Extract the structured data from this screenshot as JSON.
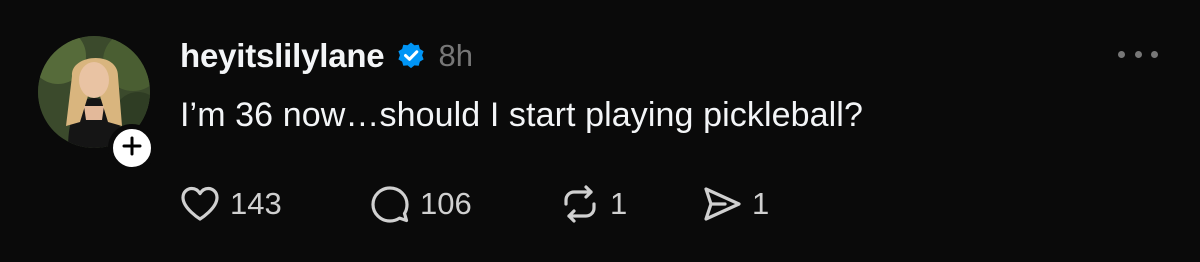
{
  "post": {
    "username": "heyitslilylane",
    "verified": true,
    "timestamp": "8h",
    "text": "I’m 36 now…should I start playing pickleball?",
    "actions": {
      "likes": "143",
      "comments": "106",
      "reposts": "1",
      "shares": "1"
    },
    "icons": {
      "like": "heart-icon",
      "comment": "comment-bubble-icon",
      "repost": "repost-icon",
      "share": "send-icon",
      "more": "more-dots-icon",
      "follow": "plus-icon",
      "verified": "verified-badge-icon"
    },
    "colors": {
      "background": "#0a0a0a",
      "text": "#f3f5f7",
      "muted": "#777777",
      "verified_blue": "#0095f6"
    }
  }
}
